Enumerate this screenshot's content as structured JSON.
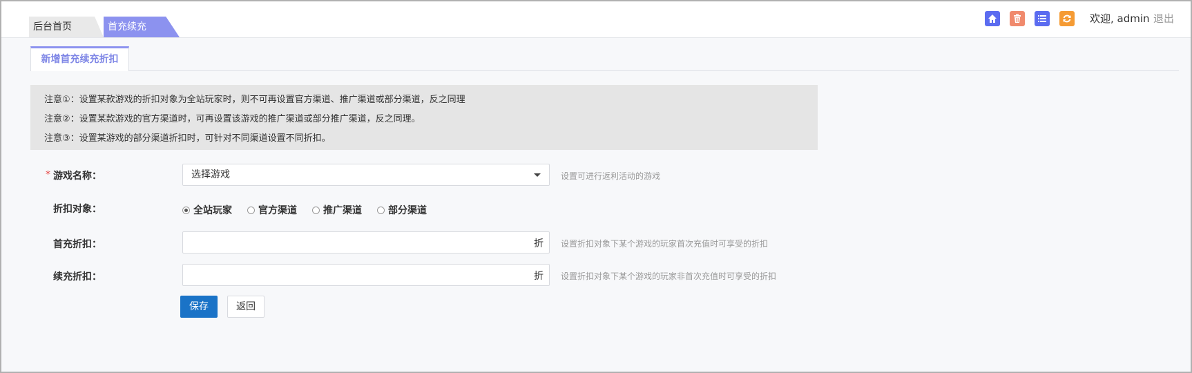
{
  "header": {
    "tabs": [
      {
        "label": "后台首页"
      },
      {
        "label": "首充续充"
      }
    ],
    "icons": [
      {
        "name": "home-icon",
        "color": "#5b6cf0"
      },
      {
        "name": "trash-icon",
        "color": "#f08a6d"
      },
      {
        "name": "list-icon",
        "color": "#5b6cf0"
      },
      {
        "name": "refresh-icon",
        "color": "#f59b34"
      }
    ],
    "welcome": "欢迎, admin",
    "logout": "退出"
  },
  "section": {
    "title": "新增首充续充折扣"
  },
  "notices": [
    "注意①：设置某款游戏的折扣对象为全站玩家时，则不可再设置官方渠道、推广渠道或部分渠道，反之同理",
    "注意②：设置某款游戏的官方渠道时，可再设置该游戏的推广渠道或部分推广渠道，反之同理。",
    "注意③：设置某游戏的部分渠道折扣时，可针对不同渠道设置不同折扣。"
  ],
  "form": {
    "required_mark": "*",
    "game": {
      "label": "游戏名称：",
      "selected": "选择游戏",
      "hint": "设置可进行返利活动的游戏"
    },
    "target": {
      "label": "折扣对象：",
      "options": [
        "全站玩家",
        "官方渠道",
        "推广渠道",
        "部分渠道"
      ],
      "selected": "全站玩家"
    },
    "first_discount": {
      "label": "首充折扣：",
      "value": "",
      "suffix": "折",
      "hint": "设置折扣对象下某个游戏的玩家首次充值时可享受的折扣"
    },
    "renew_discount": {
      "label": "续充折扣：",
      "value": "",
      "suffix": "折",
      "hint": "设置折扣对象下某个游戏的玩家非首次充值时可享受的折扣"
    },
    "save_label": "保存",
    "back_label": "返回"
  },
  "colors": {
    "accent": "#8c92ef",
    "primary_button": "#1a73c7",
    "required": "#e53935"
  }
}
